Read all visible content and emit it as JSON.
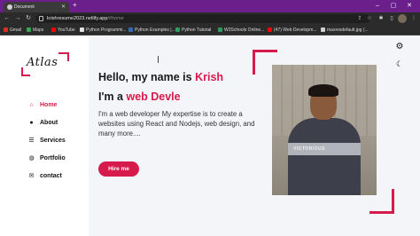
{
  "browser": {
    "tab_title": "Document",
    "url_host": "krishresume2023.netlify.app",
    "url_path": "/#home",
    "bookmarks": [
      {
        "label": "Gmail",
        "color": "#d93025"
      },
      {
        "label": "Maps",
        "color": "#34a853"
      },
      {
        "label": "YouTube",
        "color": "#ff0000"
      },
      {
        "label": "Python Programmi...",
        "color": "#e3e3e3"
      },
      {
        "label": "Python Examples |...",
        "color": "#2f6db5"
      },
      {
        "label": "Python Tutorial",
        "color": "#2e9c5c"
      },
      {
        "label": "W3Schools Online...",
        "color": "#2e9c5c"
      },
      {
        "label": "(47) Web Developm...",
        "color": "#ff0000"
      },
      {
        "label": "maxresdefault.jpg (...",
        "color": "#cfcfcf"
      }
    ]
  },
  "logo": {
    "text": "Atlas"
  },
  "menu": [
    {
      "label": "Home",
      "icon": "home-icon",
      "glyph": "⌂",
      "active": true
    },
    {
      "label": "About",
      "icon": "user-icon",
      "glyph": "●",
      "active": false
    },
    {
      "label": "Services",
      "icon": "list-icon",
      "glyph": "☰",
      "active": false
    },
    {
      "label": "Portfolio",
      "icon": "briefcase-icon",
      "glyph": "◍",
      "active": false
    },
    {
      "label": "contact",
      "icon": "chat-icon",
      "glyph": "✉",
      "active": false
    }
  ],
  "hero": {
    "hello_prefix": "Hello, my name is ",
    "name": "Krish",
    "im_prefix": "I'm a ",
    "role": "web Devle",
    "description": "I'm a web developer My expertise is to create a websites using React and Nodejs, web design, and many more....",
    "cta_label": "Hire me",
    "shirt_text": "VICTORIOUS"
  },
  "colors": {
    "accent": "#d61a4b",
    "titlebar": "#6b1f8a"
  }
}
